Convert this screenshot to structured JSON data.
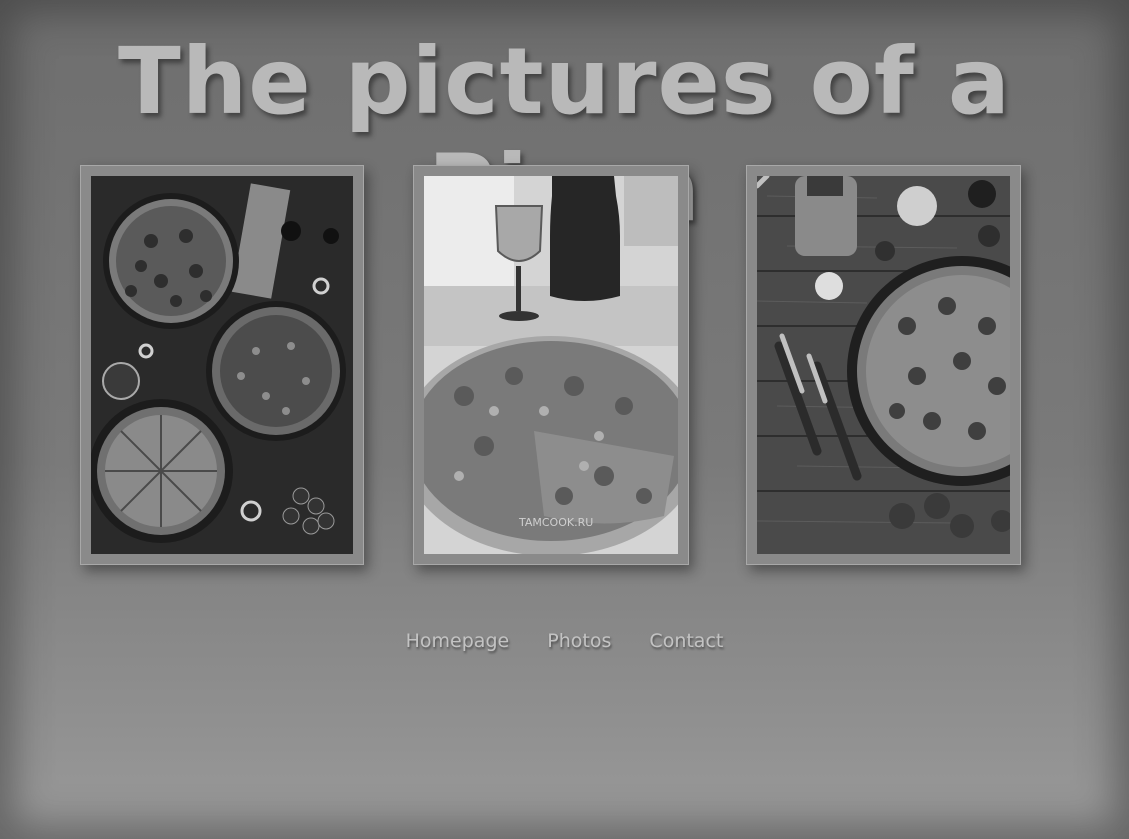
{
  "page": {
    "title": "The pictures of a Pizza"
  },
  "gallery": {
    "photos": [
      {
        "subject": "four pizzas on dark table"
      },
      {
        "subject": "sliced pizza with wine bottle and glass",
        "watermark": "TAMCOOK.RU"
      },
      {
        "subject": "pizza on wooden boards with knife and fork"
      }
    ]
  },
  "nav": {
    "items": [
      "Homepage",
      "Photos",
      "Contact"
    ]
  }
}
